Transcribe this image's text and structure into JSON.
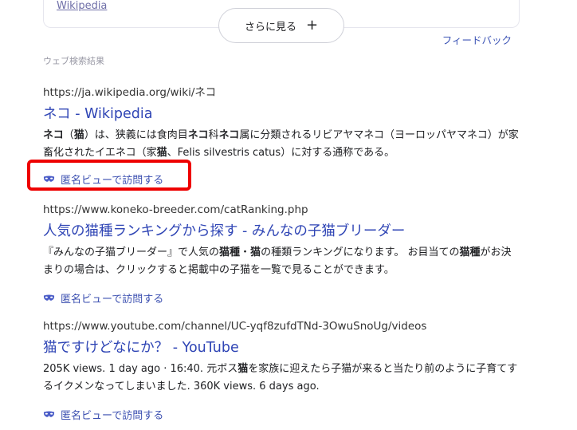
{
  "previous_card": {
    "link": "Wikipedia",
    "more_button": "さらに見る",
    "more_icon": "+",
    "feedback": "フィードバック"
  },
  "section_label": "ウェブ検索結果",
  "anon_label": "匿名ビューで訪問する",
  "anon_icon": "mask-icon",
  "highlight_color": "#ee0000",
  "link_color": "#2f45b5",
  "results": [
    {
      "url": "https://ja.wikipedia.org/wiki/ネコ",
      "title": "ネコ - Wikipedia",
      "snippet": [
        {
          "t": "ネコ",
          "b": true
        },
        {
          "t": "（",
          "b": false
        },
        {
          "t": "猫",
          "b": true
        },
        {
          "t": "）は、狭義には食肉目",
          "b": false
        },
        {
          "t": "ネコ",
          "b": true
        },
        {
          "t": "科",
          "b": false
        },
        {
          "t": "ネコ",
          "b": true
        },
        {
          "t": "属に分類されるリビアヤマネコ（ヨーロッパヤマネコ）が家畜化されたイエネコ（家",
          "b": false
        },
        {
          "t": "猫",
          "b": true
        },
        {
          "t": "、",
          "b": false
        },
        {
          "t": "Felis silvestris catus",
          "b": false
        },
        {
          "t": "）に対する通称である。",
          "b": false
        }
      ],
      "anon": "匿名ビューで訪問する"
    },
    {
      "url": "https://www.koneko-breeder.com/catRanking.php",
      "title": "人気の猫種ランキングから探す - みんなの子猫ブリーダー",
      "snippet": [
        {
          "t": "『みんなの子猫ブリーダー』で人気の",
          "b": false
        },
        {
          "t": "猫種",
          "b": true
        },
        {
          "t": "・",
          "b": false
        },
        {
          "t": "猫",
          "b": true
        },
        {
          "t": "の種類ランキングになります。 お目当ての",
          "b": false
        },
        {
          "t": "猫種",
          "b": true
        },
        {
          "t": "がお決まりの場合は、クリックすると掲載中の子猫を一覧で見ることができます。",
          "b": false
        }
      ],
      "anon": "匿名ビューで訪問する"
    },
    {
      "url": "https://www.youtube.com/channel/UC-yqf8zufdTNd-3OwuSnoUg/videos",
      "title": "猫ですけどなにか？ - YouTube",
      "snippet": [
        {
          "t": "205K views. 1 day ago · 16:40. 元ボス",
          "b": false
        },
        {
          "t": "猫",
          "b": true
        },
        {
          "t": "を家族に迎えたら子猫が来ると当たり前のように子育てするイクメンなってしまいました. 360K views. 6 days ago.",
          "b": false
        }
      ],
      "anon": "匿名ビューで訪問する"
    }
  ]
}
